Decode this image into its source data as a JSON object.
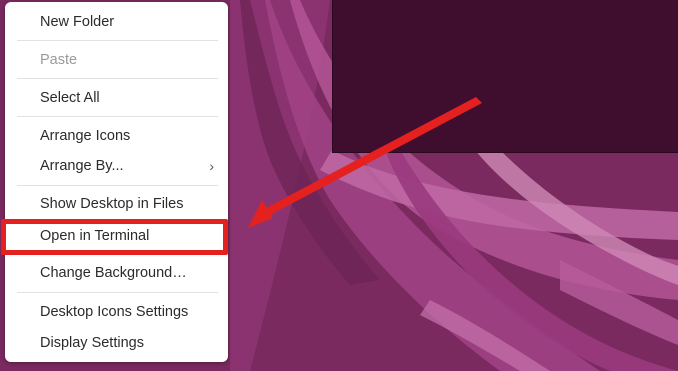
{
  "menu": {
    "items": [
      {
        "label": "New Folder",
        "disabled": false,
        "submenu": false
      },
      {
        "label": "Paste",
        "disabled": true,
        "submenu": false
      },
      {
        "label": "Select All",
        "disabled": false,
        "submenu": false
      },
      {
        "label": "Arrange Icons",
        "disabled": false,
        "submenu": false
      },
      {
        "label": "Arrange By...",
        "disabled": false,
        "submenu": true
      },
      {
        "label": "Show Desktop in Files",
        "disabled": false,
        "submenu": false
      },
      {
        "label": "Open in Terminal",
        "disabled": false,
        "submenu": false,
        "highlighted": true
      },
      {
        "label": "Change Background…",
        "disabled": false,
        "submenu": false
      },
      {
        "label": "Desktop Icons Settings",
        "disabled": false,
        "submenu": false
      },
      {
        "label": "Display Settings",
        "disabled": false,
        "submenu": false
      }
    ],
    "submenu_glyph": "›"
  },
  "annotation": {
    "color": "#e52120",
    "icon": "arrow-icon"
  },
  "colors": {
    "wallpaper_base": "#7a2a5e",
    "window_bg": "#3f0e2f",
    "menu_bg": "#ffffff",
    "disabled_text": "#9a9a9a"
  }
}
